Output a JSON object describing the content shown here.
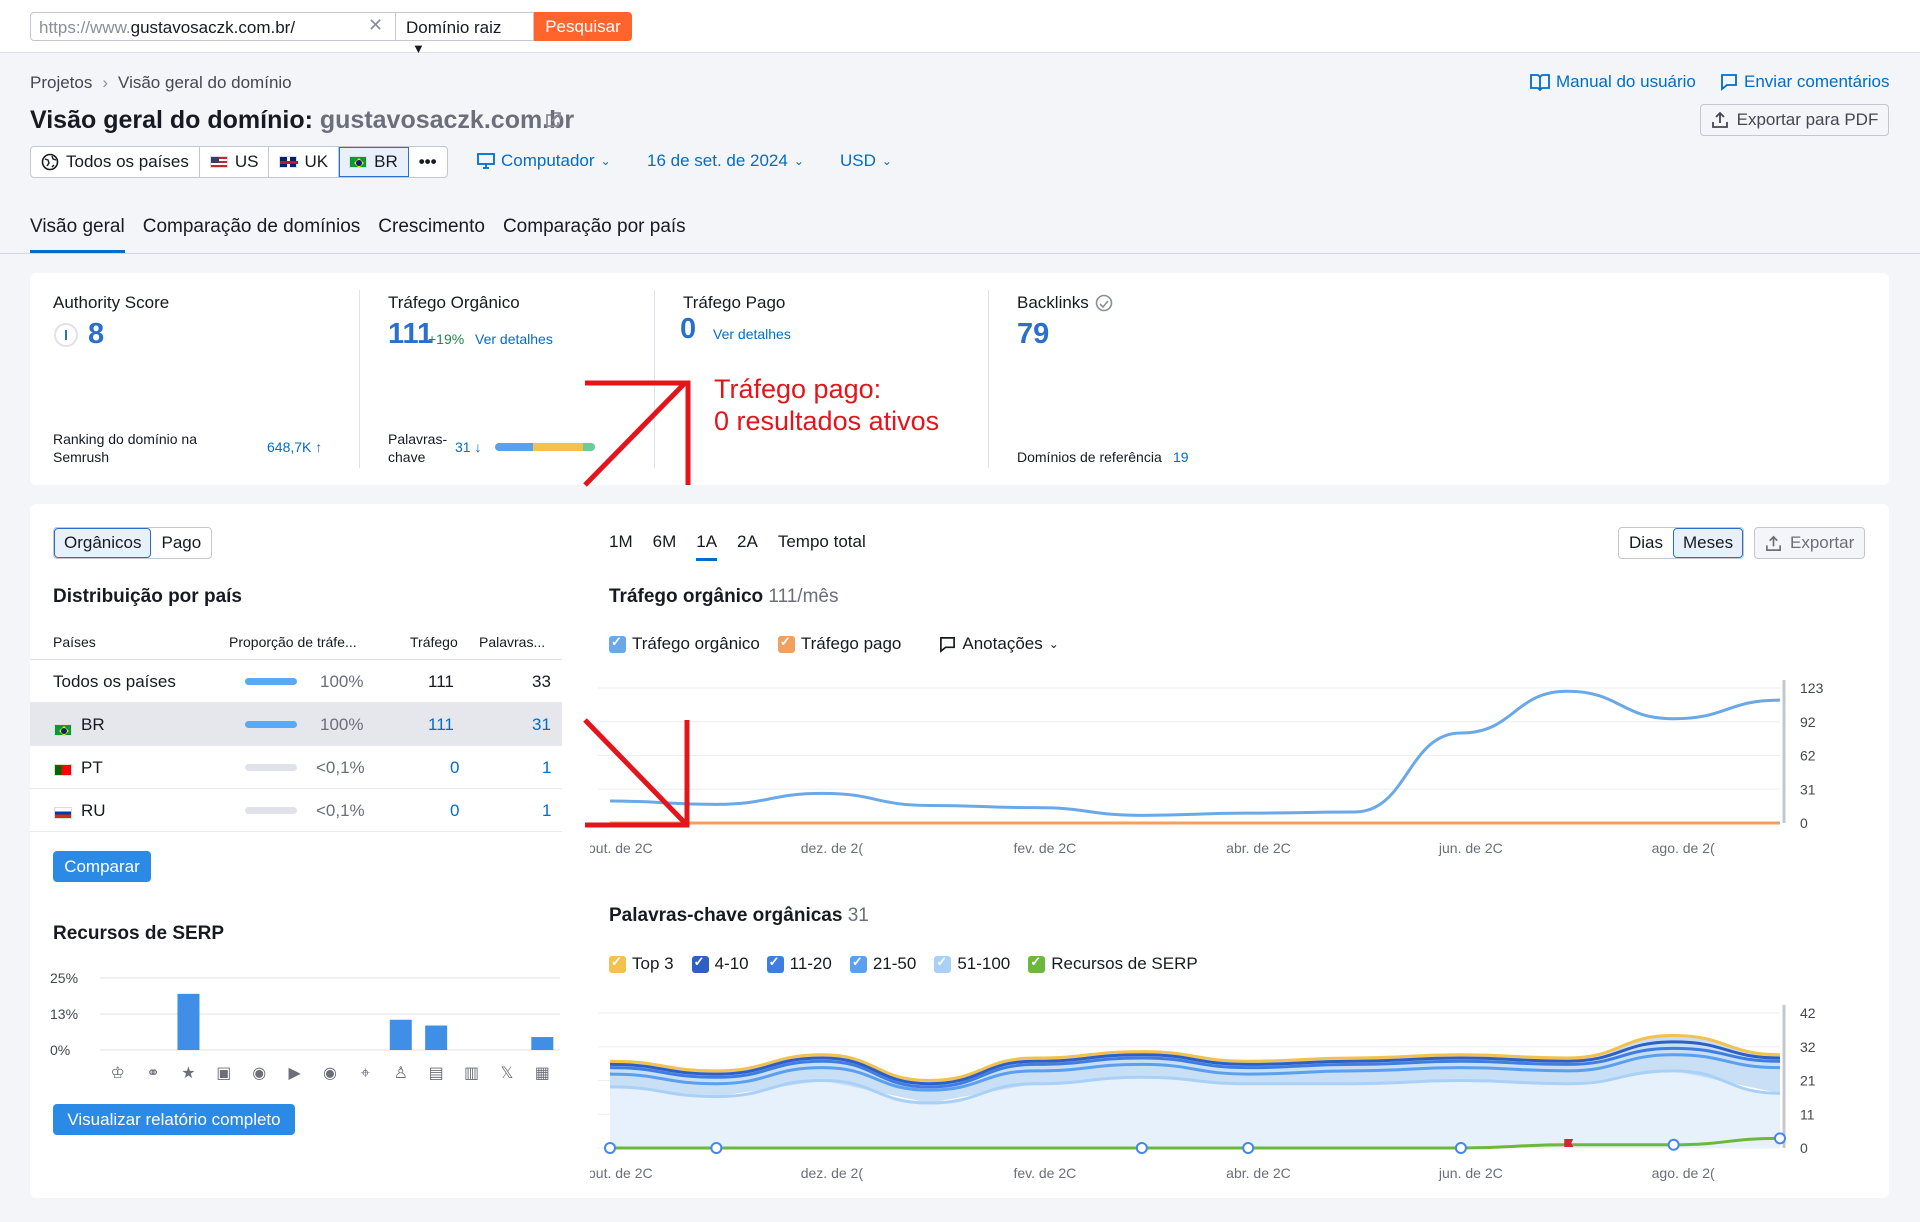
{
  "search": {
    "url_prefix": "https://www.",
    "url_domain": "gustavosaczk.com.br/",
    "mode": "Domínio raiz",
    "button": "Pesquisar"
  },
  "breadcrumb": {
    "root": "Projetos",
    "current": "Visão geral do domínio"
  },
  "header": {
    "title_prefix": "Visão geral do domínio:",
    "domain": "gustavosaczk.com.br",
    "manual_link": "Manual do usuário",
    "feedback_link": "Enviar comentários",
    "export_pdf": "Exportar para PDF"
  },
  "filters": {
    "countries": [
      "Todos os países",
      "US",
      "UK",
      "BR"
    ],
    "more": "•••",
    "device": "Computador",
    "date": "16 de set. de 2024",
    "currency": "USD"
  },
  "tabs": [
    "Visão geral",
    "Comparação de domínios",
    "Crescimento",
    "Comparação por país"
  ],
  "metrics": {
    "authority": {
      "label": "Authority Score",
      "value": "8",
      "rank_label": "Ranking do domínio na Semrush",
      "rank_value": "648,7K ↑"
    },
    "organic": {
      "label": "Tráfego Orgânico",
      "value": "111",
      "change": "+19%",
      "link": "Ver detalhes",
      "kw_label": "Palavras-chave",
      "kw_value": "31 ↓"
    },
    "paid": {
      "label": "Tráfego Pago",
      "value": "0",
      "link": "Ver detalhes"
    },
    "backlinks": {
      "label": "Backlinks",
      "value": "79",
      "ref_label": "Domínios de referência",
      "ref_value": "19"
    }
  },
  "annotation": {
    "line1": "Tráfego pago:",
    "line2": "0 resultados ativos"
  },
  "left_panel": {
    "toggle": [
      "Orgânicos",
      "Pago"
    ],
    "dist_title": "Distribuição por país",
    "columns": [
      "Países",
      "Proporção de tráfe...",
      "Tráfego",
      "Palavras..."
    ],
    "rows": [
      {
        "country": "Todos os países",
        "share": "100%",
        "share_fill": 1.0,
        "traffic": "111",
        "keywords": "33"
      },
      {
        "country": "BR",
        "share": "100%",
        "share_fill": 1.0,
        "traffic": "111",
        "keywords": "31"
      },
      {
        "country": "PT",
        "share": "<0,1%",
        "share_fill": 0,
        "traffic": "0",
        "keywords": "1"
      },
      {
        "country": "RU",
        "share": "<0,1%",
        "share_fill": 0,
        "traffic": "0",
        "keywords": "1"
      }
    ],
    "compare_button": "Comparar",
    "serp_title": "Recursos de SERP",
    "report_button": "Visualizar relatório completo"
  },
  "range_tabs": [
    "1M",
    "6M",
    "1A",
    "2A",
    "Tempo total"
  ],
  "right_controls": {
    "days": "Dias",
    "months": "Meses",
    "export": "Exportar"
  },
  "traffic_chart_header": {
    "title": "Tráfego orgânico",
    "value": "111/mês",
    "legend": [
      "Tráfego orgânico",
      "Tráfego pago"
    ],
    "annotations": "Anotações"
  },
  "keywords_chart_header": {
    "title": "Palavras-chave orgânicas",
    "value": "31",
    "legend": [
      "Top 3",
      "4-10",
      "11-20",
      "21-50",
      "51-100",
      "Recursos de SERP"
    ]
  },
  "colors": {
    "accent": "#006dca",
    "orange": "#ff642d",
    "organic": "#6aa8e8",
    "paid": "#f0a060",
    "top3": "#f2c14e",
    "kw410": "#2f5fc4",
    "kw1120": "#3f7ee0",
    "kw2150": "#5aa0ee",
    "kw51100": "#a9d0f7",
    "serp": "#6cb83a",
    "annot_red": "#e4141b"
  },
  "chart_data": [
    {
      "type": "bar",
      "title": "Recursos de SERP",
      "categories": [
        "crown",
        "link",
        "star",
        "image",
        "video",
        "video2",
        "play",
        "pin",
        "cap",
        "doc",
        "shop",
        "x",
        "news"
      ],
      "values": [
        0,
        0,
        19.5,
        0,
        0,
        0,
        0,
        0,
        10.5,
        8.5,
        0,
        0,
        4.5
      ],
      "yticks": [
        "25%",
        "13%",
        "0%"
      ],
      "ylim": [
        0,
        25
      ]
    },
    {
      "type": "line",
      "title": "Tráfego orgânico",
      "x": [
        "out. de 2C",
        "",
        "dez. de 2(",
        "",
        "fev. de 2C",
        "",
        "abr. de 2C",
        "",
        "jun. de 2C",
        "",
        "ago. de 2(",
        ""
      ],
      "series": [
        {
          "name": "Tráfego orgânico",
          "values": [
            20,
            17,
            27,
            16,
            14,
            7,
            9,
            10,
            82,
            120,
            95,
            112
          ]
        },
        {
          "name": "Tráfego pago",
          "values": [
            0,
            0,
            0,
            0,
            0,
            0,
            0,
            0,
            0,
            0,
            0,
            0
          ]
        }
      ],
      "yticks": [
        "123",
        "92",
        "62",
        "31",
        "0"
      ],
      "ylim": [
        0,
        123
      ]
    },
    {
      "type": "area",
      "title": "Palavras-chave orgânicas",
      "x": [
        "out. de 2C",
        "",
        "dez. de 2(",
        "",
        "fev. de 2C",
        "",
        "abr. de 2C",
        "",
        "jun. de 2C",
        "",
        "ago. de 2(",
        ""
      ],
      "series": [
        {
          "name": "Top 3",
          "values": [
            27,
            24,
            29,
            21,
            28,
            30,
            27,
            28,
            29,
            28,
            35,
            29
          ]
        },
        {
          "name": "4-10",
          "values": [
            26,
            23,
            28,
            20,
            27,
            29,
            26,
            27,
            28,
            27,
            33,
            28
          ]
        },
        {
          "name": "11-20",
          "values": [
            25,
            22,
            27,
            19,
            26,
            28,
            25,
            26,
            27,
            26,
            31,
            27
          ]
        },
        {
          "name": "21-50",
          "values": [
            23,
            20,
            25,
            18,
            24,
            26,
            23,
            24,
            25,
            24,
            29,
            25
          ]
        },
        {
          "name": "51-100",
          "values": [
            19,
            16,
            21,
            14,
            20,
            22,
            20,
            20,
            21,
            20,
            24,
            17
          ]
        },
        {
          "name": "Recursos de SERP",
          "values": [
            0,
            0,
            0,
            0,
            0,
            0,
            0,
            0,
            0,
            1,
            1,
            3
          ]
        }
      ],
      "yticks": [
        "42",
        "32",
        "21",
        "11",
        "0"
      ],
      "ylim": [
        0,
        42
      ]
    }
  ]
}
